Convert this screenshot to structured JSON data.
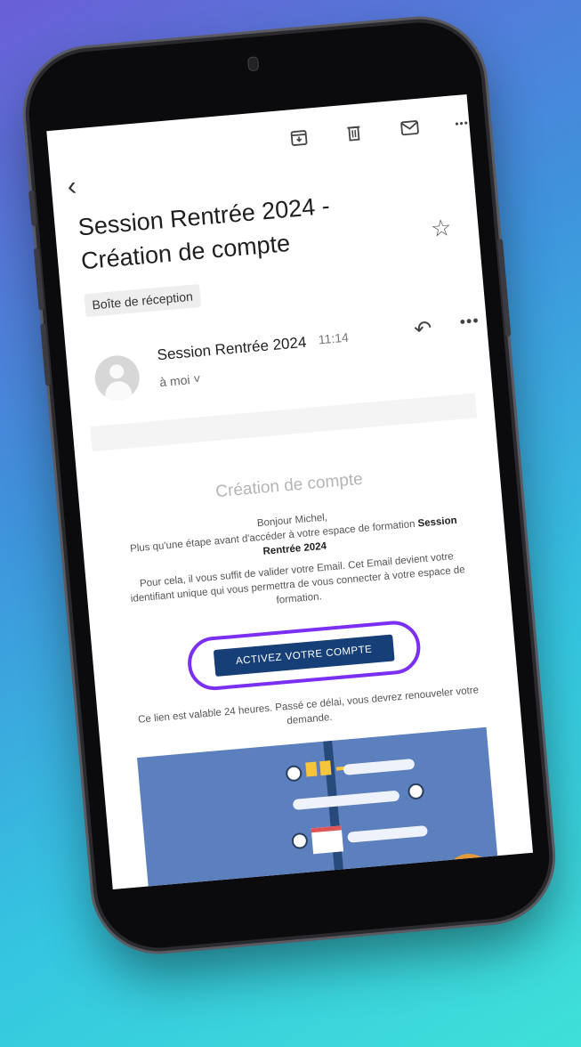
{
  "toolbar": {
    "icons": [
      "archive-icon",
      "trash-icon",
      "mail-icon",
      "more-icon"
    ],
    "more_glyph": "•••"
  },
  "email": {
    "back_glyph": "‹",
    "subject_line1": "Session Rentrée 2024 -",
    "subject_line2": "Création de compte",
    "star_glyph": "☆",
    "label": "Boîte de réception",
    "sender": "Session Rentrée 2024",
    "time": "11:14",
    "recipient": "à moi ˅",
    "reply_glyph": "↶",
    "more_glyph": "•••"
  },
  "message": {
    "title": "Création de compte",
    "greeting": "Bonjour Michel,",
    "intro_text": "Plus qu'une étape avant d'accéder à votre espace de formation ",
    "intro_bold": "Session Rentrée 2024",
    "validate_text": "Pour cela, il vous suffit de valider votre Email. Cet Email devient votre identifiant unique qui vous permettra de vous connecter à votre espace de formation.",
    "cta_label": "ACTIVEZ VOTRE COMPTE",
    "validity": "Ce lien est valable 24 heures. Passé ce délai, vous devrez renouveler votre demande."
  },
  "colors": {
    "cta_bg": "#163f77",
    "highlight_ring": "#7b2ff2",
    "illustration_bg": "#5c7fbe"
  }
}
